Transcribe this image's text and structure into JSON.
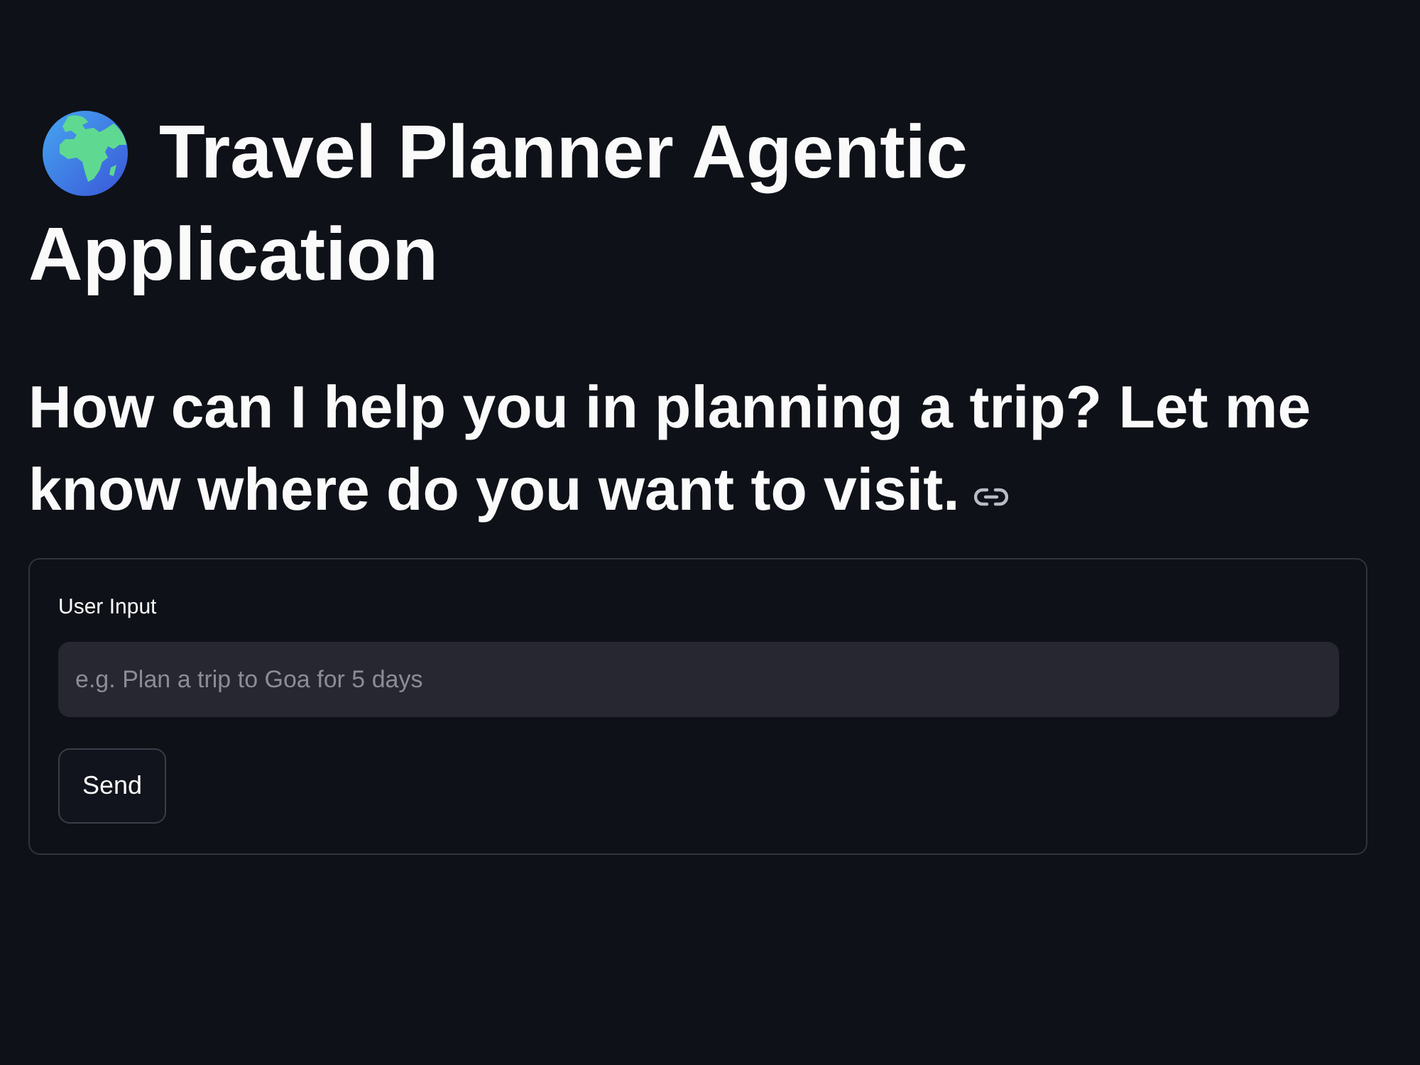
{
  "header": {
    "title_lines": [
      "Travel Planner Agentic",
      "Application"
    ],
    "subtitle_lines": [
      "How can I help you in planning a trip? Let me",
      "know where do you want to visit."
    ]
  },
  "form": {
    "field_label": "User Input",
    "input": {
      "placeholder": "e.g. Plan a trip to Goa for 5 days"
    },
    "buttons": [
      "Send"
    ]
  }
}
